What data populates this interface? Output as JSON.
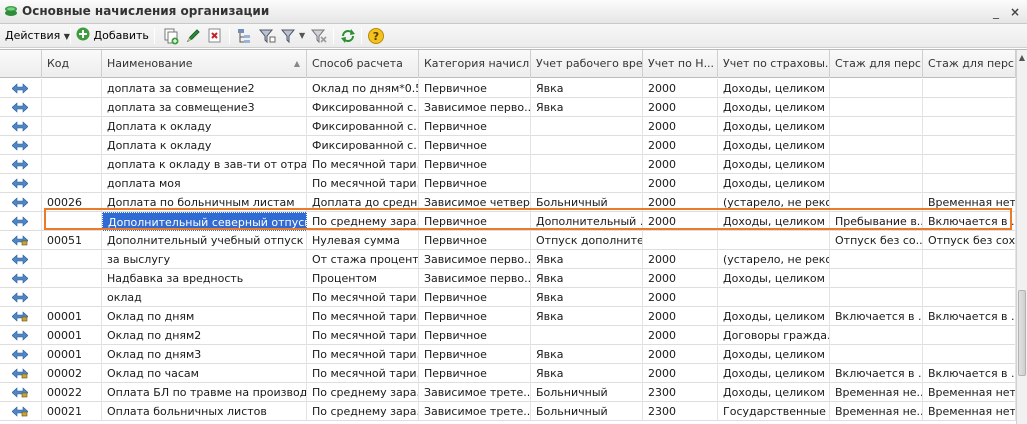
{
  "window": {
    "title": "Основные начисления организации",
    "minimize_glyph": "_",
    "close_glyph": "×"
  },
  "toolbar": {
    "actions_label": "Действия",
    "add_label": "Добавить"
  },
  "grid": {
    "columns": [
      "Код",
      "Наименование",
      "Способ расчета",
      "Категория начисл...",
      "Учет рабочего вре...",
      "Учет по Н...",
      "Учет по страховы...",
      "Стаж для перс...",
      "Стаж для перс..."
    ],
    "selected_row": 7,
    "rows": [
      {
        "icon": "calc-kind-icon",
        "cells": [
          "",
          "доплата за совмещение2",
          "Оклад по дням*0.5",
          "Первичное",
          "Явка",
          "2000",
          "Доходы, целиком ...",
          "",
          ""
        ]
      },
      {
        "icon": "calc-kind-icon",
        "cells": [
          "",
          "доплата за совмещение3",
          "Фиксированной с...",
          "Зависимое перво...",
          "Явка",
          "2000",
          "Доходы, целиком ...",
          "",
          ""
        ]
      },
      {
        "icon": "calc-kind-icon",
        "cells": [
          "",
          "Доплата к окладу",
          "Фиксированной с...",
          "Первичное",
          "",
          "2000",
          "Доходы, целиком ...",
          "",
          ""
        ]
      },
      {
        "icon": "calc-kind-icon",
        "cells": [
          "",
          "Доплата к окладу",
          "Фиксированной с...",
          "Первичное",
          "",
          "2000",
          "Доходы, целиком ...",
          "",
          ""
        ]
      },
      {
        "icon": "calc-kind-icon",
        "cells": [
          "",
          "доплата к окладу в зав-ти от отрабо...",
          "По месячной тари...",
          "Первичное",
          "",
          "2000",
          "Доходы, целиком ...",
          "",
          ""
        ]
      },
      {
        "icon": "calc-kind-icon",
        "cells": [
          "",
          "доплата моя",
          "По месячной тари...",
          "Первичное",
          "",
          "2000",
          "Доходы, целиком ...",
          "",
          ""
        ]
      },
      {
        "icon": "calc-kind-icon",
        "cells": [
          "00026",
          "Доплата по больничным листам",
          "Доплата до средн...",
          "Зависимое четвер...",
          "Больничный",
          "2000",
          "(устарело, не реко...",
          "",
          "Временная нет..."
        ]
      },
      {
        "icon": "calc-kind-icon",
        "cells": [
          "",
          "Дополнительный северный отпуск",
          "По среднему зара...",
          "Первичное",
          "Дополнительный ...",
          "2000",
          "Доходы, целиком ...",
          "Пребывание в...",
          "Включается в ..."
        ]
      },
      {
        "icon": "calc-kind-lock-icon",
        "cells": [
          "00051",
          "Дополнительный учебный отпуск бе...",
          "Нулевая сумма",
          "Первичное",
          "Отпуск дополните...",
          "",
          "",
          "Отпуск без со...",
          "Отпуск без сох..."
        ]
      },
      {
        "icon": "calc-kind-icon",
        "cells": [
          "",
          "за выслугу",
          "От стажа процент...",
          "Зависимое перво...",
          "Явка",
          "2000",
          "(устарело, не реко...",
          "",
          ""
        ]
      },
      {
        "icon": "calc-kind-icon",
        "cells": [
          "",
          "Надбавка за вредность",
          "Процентом",
          "Зависимое перво...",
          "Явка",
          "2000",
          "Доходы, целиком ...",
          "",
          ""
        ]
      },
      {
        "icon": "calc-kind-icon",
        "cells": [
          "",
          "оклад",
          "По месячной тари...",
          "Первичное",
          "Явка",
          "2000",
          "",
          "",
          ""
        ]
      },
      {
        "icon": "calc-kind-lock-icon",
        "cells": [
          "00001",
          "Оклад по дням",
          "По месячной тари...",
          "Первичное",
          "Явка",
          "2000",
          "Доходы, целиком ...",
          "Включается в ...",
          "Включается в ..."
        ]
      },
      {
        "icon": "calc-kind-icon",
        "cells": [
          "00001",
          "Оклад по дням2",
          "По месячной тари...",
          "Первичное",
          "",
          "2000",
          "Договоры гражда...",
          "",
          ""
        ]
      },
      {
        "icon": "calc-kind-icon",
        "cells": [
          "00001",
          "Оклад по дням3",
          "По месячной тари...",
          "Первичное",
          "Явка",
          "2000",
          "Доходы, целиком ...",
          "",
          ""
        ]
      },
      {
        "icon": "calc-kind-lock-icon",
        "cells": [
          "00002",
          "Оклад по часам",
          "По месячной тари...",
          "Первичное",
          "Явка",
          "2000",
          "Доходы, целиком ...",
          "Включается в ...",
          "Включается в ..."
        ]
      },
      {
        "icon": "calc-kind-lock-icon",
        "cells": [
          "00022",
          "Оплата БЛ по травме на производст...",
          "По среднему зара...",
          "Зависимое трете...",
          "Больничный",
          "2300",
          "Доходы, целиком ...",
          "Временная не...",
          "Временная нет..."
        ]
      },
      {
        "icon": "calc-kind-lock-icon",
        "cells": [
          "00021",
          "Оплата больничных листов",
          "По среднему зара...",
          "Зависимое трете...",
          "Больничный",
          "2300",
          "Государственные ...",
          "Временная не...",
          "Временная нет..."
        ]
      }
    ]
  }
}
